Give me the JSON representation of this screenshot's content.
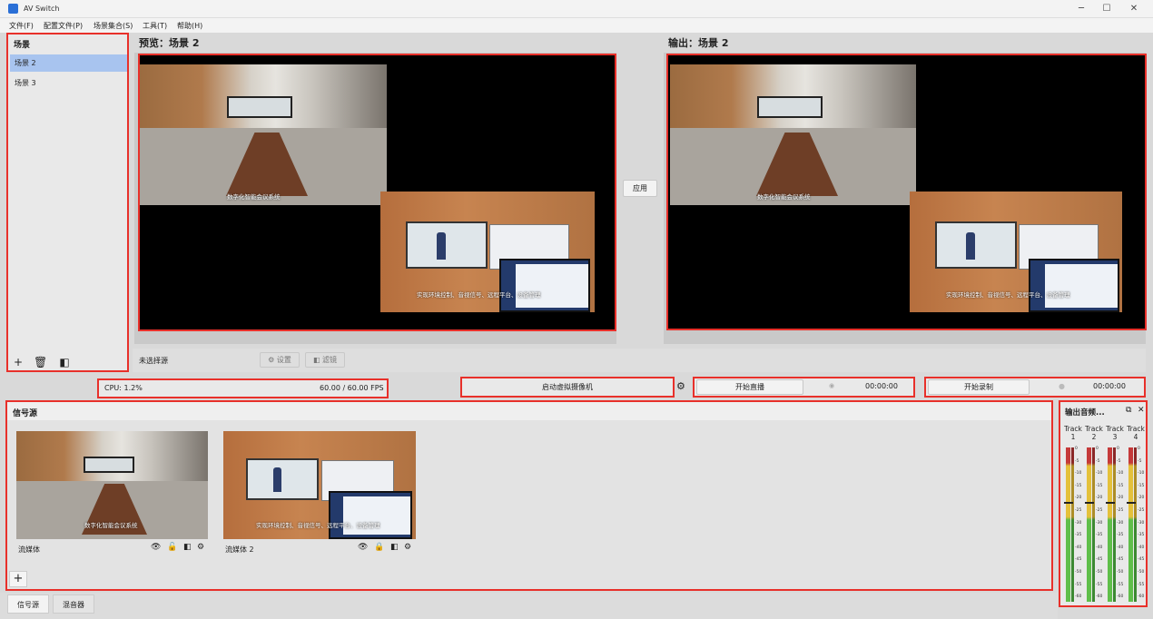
{
  "window": {
    "title": "AV Switch"
  },
  "menu": [
    "文件(F)",
    "配置文件(P)",
    "场景集合(S)",
    "工具(T)",
    "帮助(H)"
  ],
  "scenes": {
    "header": "场景",
    "items": [
      "场景 2",
      "场景 3"
    ],
    "selected": "场景 2"
  },
  "preview": {
    "title": "预览：场景 2",
    "caption_top": "数字化智能会议系统",
    "caption_bottom": "实现环境控制、音视信号、远程平台、设备管理",
    "apply_button": "应用"
  },
  "output": {
    "title": "输出：场景 2",
    "caption_top": "数字化智能会议系统",
    "caption_bottom": "实现环境控制、音视信号、远程平台、设备管理"
  },
  "source_toolbar": {
    "status": "未选择源",
    "settings": "设置",
    "filters": "滤镜"
  },
  "status": {
    "cpu": "CPU: 1.2%",
    "fps": "60.00 / 60.00 FPS"
  },
  "virtual_camera": {
    "label": "启动虚拟摄像机"
  },
  "stream": {
    "label": "开始直播",
    "time": "00:00:00"
  },
  "record": {
    "label": "开始录制",
    "time": "00:00:00"
  },
  "sources": {
    "header": "信号源",
    "items": [
      {
        "name": "流媒体",
        "caption": "数字化智能会议系统"
      },
      {
        "name": "流媒体 2",
        "caption": "实现环境控制、音视信号、远程平台、设备管理"
      }
    ]
  },
  "audio": {
    "header": "输出音频...",
    "tracks": [
      {
        "label": "Track",
        "num": "1"
      },
      {
        "label": "Track",
        "num": "2"
      },
      {
        "label": "Track",
        "num": "3"
      },
      {
        "label": "Track",
        "num": "4"
      }
    ],
    "scale": [
      "0",
      "-5",
      "-10",
      "-15",
      "-20",
      "-25",
      "-30",
      "-35",
      "-40",
      "-45",
      "-50",
      "-55",
      "-60"
    ]
  },
  "tabs": [
    "信号源",
    "混音器"
  ]
}
